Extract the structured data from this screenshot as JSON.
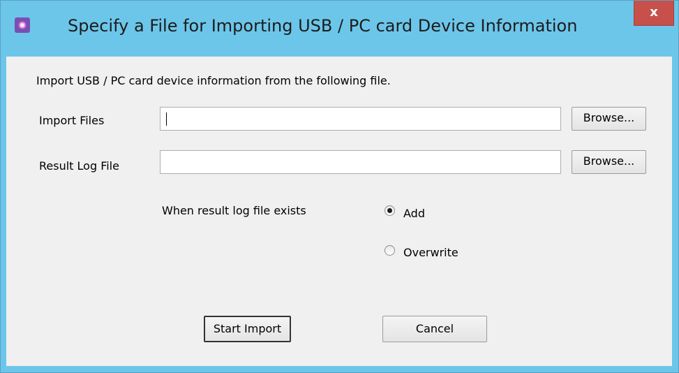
{
  "window": {
    "title": "Specify a File for Importing USB / PC card Device Information",
    "close_label": "x"
  },
  "form": {
    "instruction": "Import USB / PC card device information from the following file.",
    "import_files": {
      "label": "Import Files",
      "value": "",
      "browse_label": "Browse..."
    },
    "result_log_file": {
      "label": "Result Log File",
      "value": "",
      "browse_label": "Browse..."
    },
    "when_exists": {
      "label": "When result log file exists",
      "options": [
        {
          "label": "Add",
          "selected": true
        },
        {
          "label": "Overwrite",
          "selected": false
        }
      ]
    }
  },
  "buttons": {
    "start_import": "Start Import",
    "cancel": "Cancel"
  }
}
